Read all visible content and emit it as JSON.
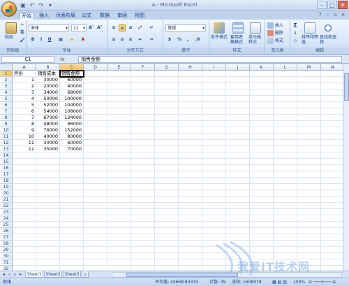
{
  "window": {
    "title": "A - Microsoft Excel",
    "controls": [
      "–",
      "□",
      "✕"
    ]
  },
  "tabs": [
    "开始",
    "插入",
    "页面布局",
    "公式",
    "数据",
    "审阅",
    "视图"
  ],
  "ribbon": {
    "clipboard": {
      "paste": "粘贴",
      "label": "剪贴板"
    },
    "font": {
      "name": "宋体",
      "size": "11",
      "grow": "A˄",
      "shrink": "A˅",
      "bold": "B",
      "italic": "I",
      "underline": "U",
      "label": "字体"
    },
    "alignment": {
      "label": "对齐方式"
    },
    "number": {
      "format": "常规",
      "percent": "%",
      "comma": ",",
      "label": "数字"
    },
    "styles": {
      "conditional": "条件格式",
      "table": "套用表格格式",
      "cell": "单元格样式",
      "label": "样式"
    },
    "cells": {
      "insert": "插入",
      "delete": "删除",
      "format": "格式",
      "label": "单元格"
    },
    "editing": {
      "sigma": "Σ",
      "sort": "排序和筛选",
      "find": "查找和选择",
      "label": "编辑"
    }
  },
  "formula_bar": {
    "name_box": "C1",
    "fx": "fx",
    "content": "销售金额"
  },
  "columns": [
    "A",
    "B",
    "C",
    "D",
    "E",
    "F",
    "G",
    "H",
    "I",
    "J",
    "K",
    "L",
    "M",
    "N"
  ],
  "rows": [
    [
      "月份",
      "销售成本",
      "销售金额"
    ],
    [
      "1",
      "30000",
      "60000"
    ],
    [
      "2",
      "20000",
      "40000"
    ],
    [
      "3",
      "34000",
      "68000"
    ],
    [
      "4",
      "50000",
      "100000"
    ],
    [
      "5",
      "52000",
      "104000"
    ],
    [
      "6",
      "54000",
      "108000"
    ],
    [
      "7",
      "67000",
      "134000"
    ],
    [
      "8",
      "48000",
      "96000"
    ],
    [
      "9",
      "76000",
      "152000"
    ],
    [
      "10",
      "40000",
      "80000"
    ],
    [
      "11",
      "30000",
      "60000"
    ],
    [
      "12",
      "35000",
      "70000"
    ]
  ],
  "row_count": 33,
  "sheets": [
    "Sheet1",
    "Sheet2",
    "Sheet3"
  ],
  "status": {
    "ready": "就绪",
    "average": "平均值: 44668.83333",
    "count": "计数: 39",
    "sum": "求和: 1608078",
    "zoom": "100%"
  },
  "watermark": "我爱IT技术网"
}
